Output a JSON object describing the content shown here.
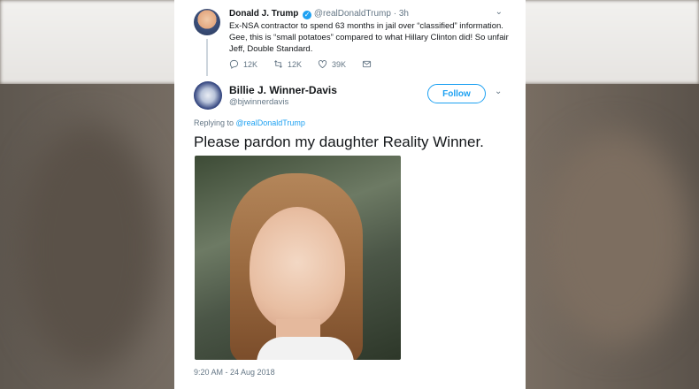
{
  "quoted_tweet": {
    "name": "Donald J. Trump",
    "handle": "@realDonaldTrump",
    "time": "· 3h",
    "text": "Ex-NSA contractor to spend 63 months in jail over “classified” information. Gee, this is “small potatoes” compared to what Hillary Clinton did! So unfair Jeff, Double Standard.",
    "actions": {
      "replies": "12K",
      "retweets": "12K",
      "likes": "39K"
    }
  },
  "tweet": {
    "name": "Billie J. Winner-Davis",
    "handle": "@bjwinnerdavis",
    "follow_label": "Follow",
    "replying_prefix": "Replying to",
    "replying_to": "@realDonaldTrump",
    "text": "Please pardon my daughter Reality Winner.",
    "timestamp": "9:20 AM - 24 Aug 2018"
  },
  "colors": {
    "accent": "#1da1f2",
    "text": "#14171a",
    "muted": "#657786"
  }
}
